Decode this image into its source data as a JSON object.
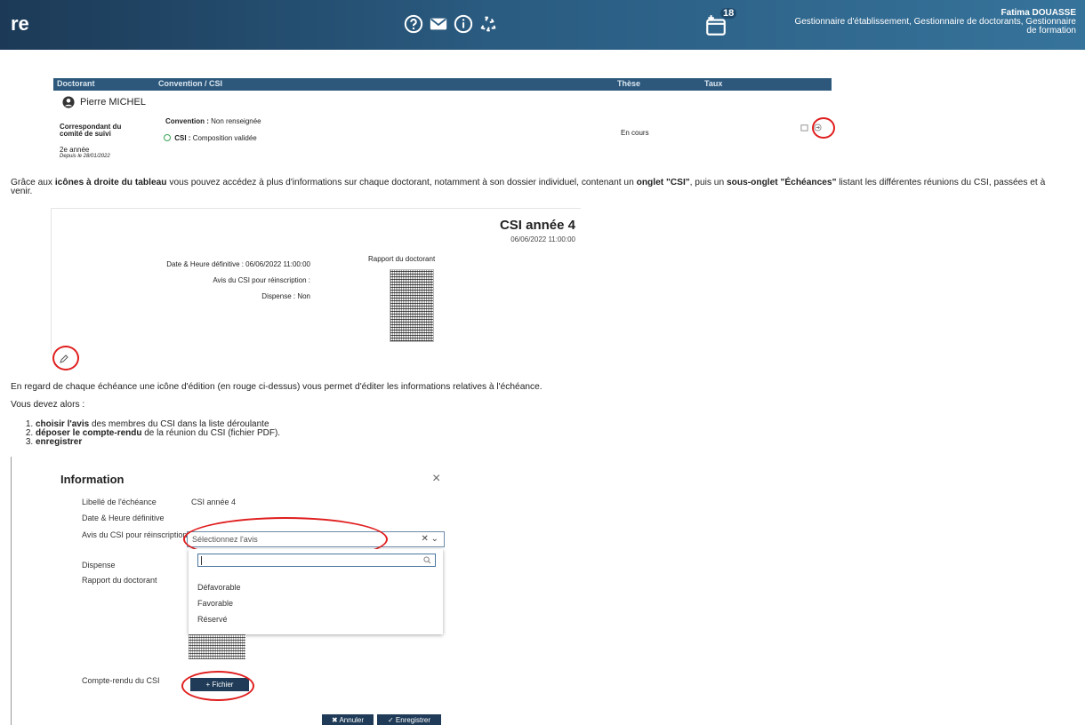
{
  "header": {
    "brand": "re",
    "notification_count": "18",
    "user_name": "Fatima DOUASSE",
    "user_roles": "Gestionnaire d'établissement, Gestionnaire de doctorants, Gestionnaire de formation",
    "icons": [
      "help-icon",
      "mail-icon",
      "info-icon",
      "recycle-icon",
      "calendar-add-icon"
    ]
  },
  "table": {
    "headers": [
      "Doctorant",
      "Convention / CSI",
      "Thèse",
      "Taux"
    ],
    "row": {
      "name": "Pierre MICHEL",
      "role": "Correspondant du comité de suivi",
      "year": "2e année",
      "since": "Depuis le 28/01/2022",
      "convention_label": "Convention :",
      "convention_value": "Non renseignée",
      "csi_label": "CSI :",
      "csi_value": "Composition validée",
      "these": "En cours"
    }
  },
  "para1": {
    "t1": "Grâce aux ",
    "b1": "icônes à droite du tableau",
    "t2": " vous pouvez accédez à plus d'informations sur chaque doctorant, notamment à son dossier individuel, contenant un ",
    "b2": "onglet \"CSI\"",
    "t3": ", puis un ",
    "b3": "sous-onglet \"Échéances\"",
    "t4": " listant les différentes réunions du CSI, passées et à",
    "t5": "venir."
  },
  "csi_card": {
    "title": "CSI année 4",
    "date": "06/06/2022 11:00:00",
    "date_heure": "Date & Heure définitive : 06/06/2022 11:00:00",
    "avis": "Avis du CSI pour réinscription :",
    "dispense": "Dispense : Non",
    "rapport": "Rapport du doctorant"
  },
  "para2": "En regard de chaque échéance une icône d'édition (en rouge ci-dessus) vous permet d'éditer les informations relatives à l'échéance.",
  "para3": "Vous devez alors :",
  "steps": [
    {
      "bold": "choisir l'avis",
      "rest": " des membres du CSI dans la liste déroulante"
    },
    {
      "bold": "déposer le compte-rendu",
      "rest": " de la réunion du CSI (fichier PDF)."
    },
    {
      "bold": "enregistrer",
      "rest": ""
    }
  ],
  "modal": {
    "title": "Information",
    "close": "×",
    "labels": {
      "libelle": "Libellé de l'échéance",
      "date": "Date & Heure définitive",
      "avis": "Avis du CSI pour réinscription",
      "dispense": "Dispense",
      "rapport": "Rapport du doctorant",
      "compte_rendu": "Compte-rendu du CSI"
    },
    "libelle_value": "CSI année 4",
    "select_placeholder": "Sélectionnez l'avis",
    "options": [
      "Défavorable",
      "Favorable",
      "Réservé"
    ],
    "fichier": "+ Fichier",
    "annuler": "Annuler",
    "enregistrer": "Enregistrer"
  }
}
